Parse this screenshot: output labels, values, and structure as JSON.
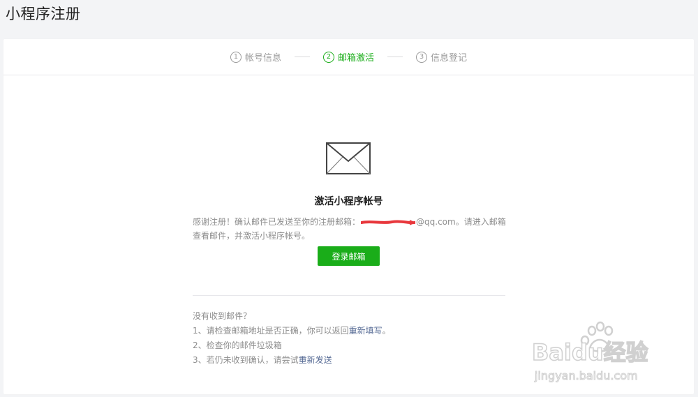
{
  "page_title": "小程序注册",
  "steps": [
    {
      "num": "1",
      "label": "帐号信息"
    },
    {
      "num": "2",
      "label": "邮箱激活"
    },
    {
      "num": "3",
      "label": "信息登记"
    }
  ],
  "main": {
    "icon": "envelope-icon",
    "title": "激活小程序帐号",
    "desc_prefix": "感谢注册！确认邮件已发送至你的注册邮箱：",
    "desc_email_suffix": "@qq.com",
    "desc_suffix": "。请进入邮箱查看邮件，并激活小程序帐号。",
    "login_button": "登录邮箱"
  },
  "tips": {
    "heading": "没有收到邮件？",
    "item1_text": "1、请检查邮箱地址是否正确，你可以返回",
    "item1_link": "重新填写",
    "item1_end": "。",
    "item2_text": "2、检查你的邮件垃圾箱",
    "item3_text": "3、若仍未收到确认，请尝试",
    "item3_link": "重新发送"
  },
  "watermark": {
    "brand": "Baidu经验",
    "url": "jingyan.baidu.com"
  },
  "colors": {
    "accent": "#1aad19",
    "link": "#576b95",
    "redaction": "#e8383d"
  }
}
